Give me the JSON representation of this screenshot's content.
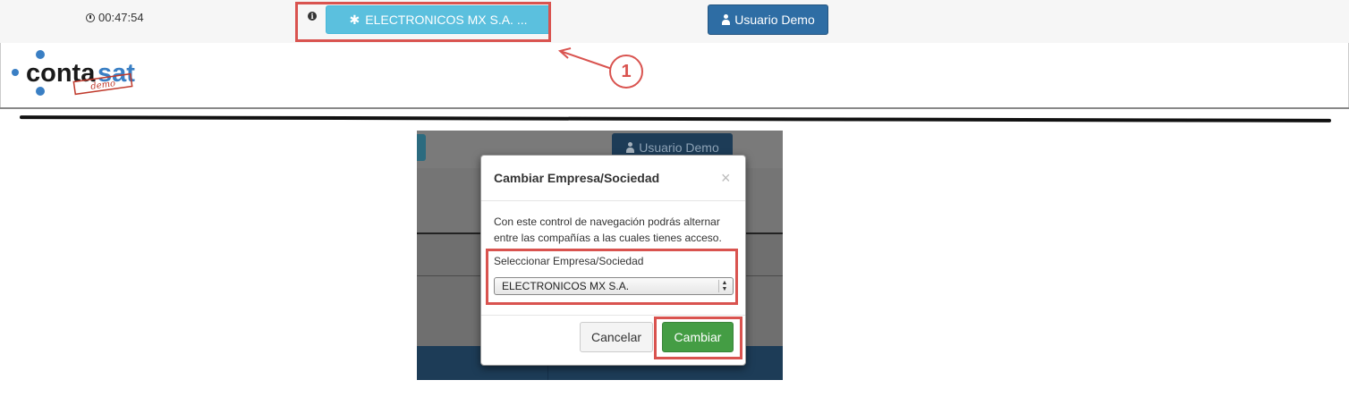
{
  "topbar": {
    "timer": "00:47:54",
    "company_button": "ELECTRONICOS MX S.A. ...",
    "company_button_icon": "asterisk-icon",
    "user_button": "Usuario Demo",
    "user_icon": "user-icon",
    "info_icon": "info-icon"
  },
  "logo": {
    "text_part1": "conta",
    "text_part2": "sat",
    "stamp": "demo"
  },
  "callout": {
    "number": "1"
  },
  "screenshot": {
    "user_button": "Usuario Demo",
    "modal": {
      "title": "Cambiar Empresa/Sociedad",
      "close": "×",
      "description": "Con este control de navegación podrás alternar entre las compañías a las cuales tienes acceso.",
      "field_label": "Seleccionar Empresa/Sociedad",
      "selected_value": "ELECTRONICOS MX S.A.",
      "cancel_label": "Cancelar",
      "change_label": "Cambiar"
    }
  },
  "colors": {
    "accent_info": "#5bc0de",
    "primary": "#2e6da4",
    "success": "#449d44",
    "highlight": "#d9534f"
  }
}
